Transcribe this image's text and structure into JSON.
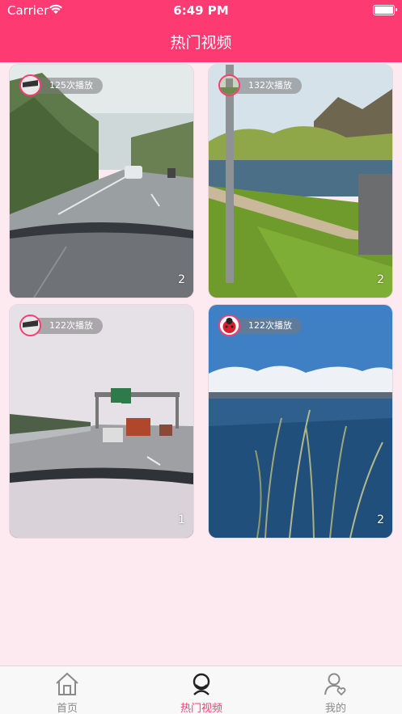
{
  "status": {
    "carrier": "Carrier",
    "time": "6:49 PM"
  },
  "header": {
    "title": "热门视频"
  },
  "videos": [
    {
      "plays": "125次播放",
      "count": "2",
      "avatar_icon": "car-dashboard-avatar",
      "scene": "highway-through-windshield"
    },
    {
      "plays": "132次播放",
      "count": "2",
      "avatar_icon": "building-avatar",
      "scene": "river-bank-with-pole"
    },
    {
      "plays": "122次播放",
      "count": "1",
      "avatar_icon": "car-dashboard-avatar",
      "scene": "highway-with-sign-gantry"
    },
    {
      "plays": "122次播放",
      "count": "2",
      "avatar_icon": "ladybug-avatar",
      "scene": "lake-with-reeds"
    }
  ],
  "tabs": [
    {
      "label": "首页",
      "icon": "home-icon"
    },
    {
      "label": "热门视频",
      "icon": "hot-video-icon"
    },
    {
      "label": "我的",
      "icon": "profile-icon"
    }
  ],
  "colors": {
    "accent": "#fe3a72",
    "background": "#fdeaf0"
  }
}
